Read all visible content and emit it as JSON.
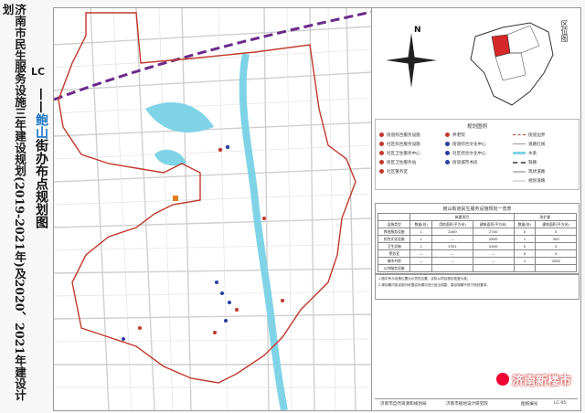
{
  "title_vertical": "济南市民生服务设施三年建设规划(2019-2021年)及2020、2021年建设计划",
  "map_code": "LC",
  "subtitle_prefix": "——",
  "subtitle_highlight": "鲍山",
  "subtitle_rest": "街办布点规划图",
  "compass_label": "N",
  "inset_label": "区位图",
  "legend": {
    "title": "规划图例",
    "items": [
      {
        "label": "街道综合服务设施",
        "color": "#c0392b"
      },
      {
        "label": "社区综合服务设施",
        "color": "#c0392b"
      },
      {
        "label": "社区卫生服务中心",
        "color": "#c0392b"
      },
      {
        "label": "街区卫生服务站",
        "color": "#c0392b"
      },
      {
        "label": "社区警务室",
        "color": "#c0392b"
      },
      {
        "label": "养老院",
        "color": "#c0392b"
      },
      {
        "label": "街道综合文化中心",
        "color": "#2c3e9e"
      },
      {
        "label": "社区综合文化中心",
        "color": "#2c3e9e"
      },
      {
        "label": "街道城市书房",
        "color": "#2c3e9e"
      },
      {
        "label": "街道边界",
        "color": "#c0392b"
      },
      {
        "label": "道路红线",
        "color": "#999999"
      },
      {
        "label": "水系",
        "color": "#7fd3e6"
      },
      {
        "label": "铁路",
        "color": "#666666"
      },
      {
        "label": "现状道路",
        "color": "#bbbbbb"
      },
      {
        "label": "规划道路",
        "color": "#dddddd"
      }
    ]
  },
  "table": {
    "title": "鲍山街道民生服务设施规划一览表",
    "headers": [
      "设施类型",
      "数量(处)",
      "用地面积(平方米)",
      "建筑面积(平方米)",
      "数量(处)",
      "建筑面积(平方米)"
    ],
    "group_headers": [
      "",
      "新建项目",
      "",
      "",
      "改扩建",
      ""
    ],
    "rows": [
      [
        "养老服务设施",
        "1",
        "2000",
        "2700",
        "0",
        "0"
      ],
      [
        "综合文化设施",
        "1",
        "—",
        "2600",
        "1",
        "300"
      ],
      [
        "卫生设施",
        "1",
        "3351",
        "5400",
        "0",
        "0"
      ],
      [
        "警务室",
        "—",
        "—",
        "—",
        "0",
        "0"
      ],
      [
        "城市书房",
        "—",
        "—",
        "—",
        "1",
        "2000"
      ],
      [
        "公共服务设施",
        "",
        "",
        "",
        "",
        ""
      ]
    ]
  },
  "notes": [
    "1.图中所示设施位置为示意性位置，实际以项目规划批复为准。",
    "2.规划期内各设施可依据实际情况进行适当调整，建设规模不低于规划要求。"
  ],
  "footer": {
    "left": "济南市自然资源和规划局",
    "center": "济南市规划设计研究院",
    "right_label": "图纸编号",
    "right_code": "LC-05"
  },
  "watermark": "济南新楼市",
  "colors": {
    "boundary": "#c0392b",
    "water": "#7fd3e6",
    "railway_dash": "#6a2a8a",
    "road": "#cfcfcf"
  }
}
